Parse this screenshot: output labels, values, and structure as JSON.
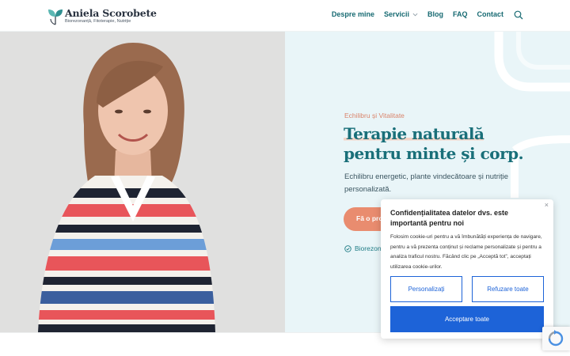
{
  "header": {
    "logo_name": "Aniela Scorobete",
    "logo_tagline": "Biorezonanță, Fitoterapie, Nutriție",
    "nav": [
      "Despre mine",
      "Servicii",
      "Blog",
      "FAQ",
      "Contact"
    ]
  },
  "hero": {
    "eyebrow": "Echilibru și Vitalitate",
    "headline_line1": "Terapie naturală",
    "headline_line2": "pentru minte și corp.",
    "lede": "Echilibru energetic, plante vindecătoare și nutriție personalizată.",
    "cta_label": "Fă o pro",
    "badge_text": "Biorezona"
  },
  "cookie": {
    "title": "Confidențialitatea datelor dvs. este importantă pentru noi",
    "body": "Folosim cookie-uri pentru a vă îmbunătăți experiența de navigare, pentru a vă prezenta conținut și reclame personalizate și pentru a analiza traficul nostru. Făcând clic pe „Acceptă tot”, acceptați utilizarea cookie-urilor.",
    "customize_label": "Personalizați",
    "reject_label": "Refuzare toate",
    "accept_label": "Acceptare toate",
    "close_symbol": "×"
  },
  "colors": {
    "teal": "#196f79",
    "coral": "#e98c6f",
    "hero_bg": "#e9f5f8",
    "consent_blue": "#1d63d8"
  }
}
